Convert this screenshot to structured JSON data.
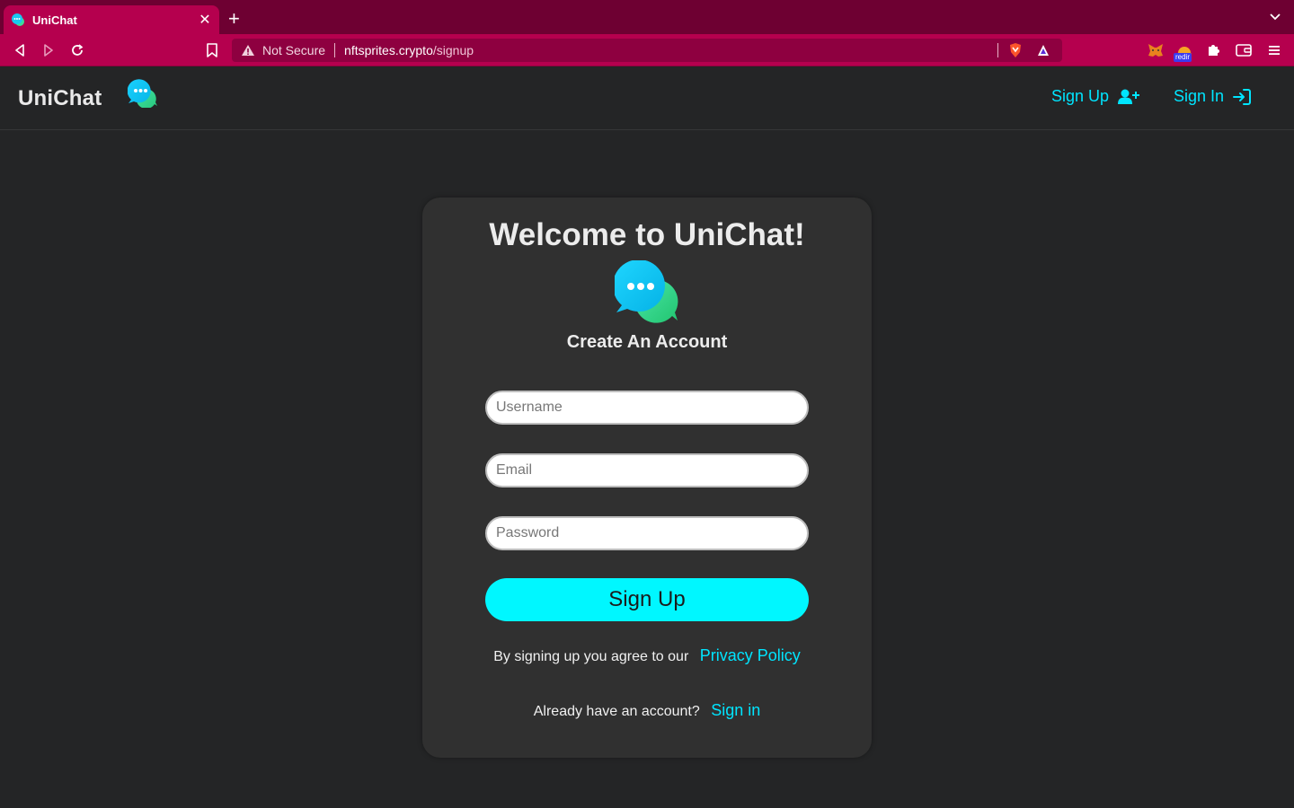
{
  "browser": {
    "tab_title": "UniChat",
    "url_security": "Not Secure",
    "url_host": "nftsprites.crypto",
    "url_path": "/signup",
    "extension_badge": "redir",
    "chrome_color": "#b5004e"
  },
  "header": {
    "brand": "UniChat",
    "signup_label": "Sign Up",
    "signin_label": "Sign In",
    "accent_color": "#00e5ff"
  },
  "card": {
    "title": "Welcome to UniChat!",
    "subtitle": "Create An Account",
    "username_placeholder": "Username",
    "email_placeholder": "Email",
    "password_placeholder": "Password",
    "submit_label": "Sign Up",
    "agree_text": "By signing up you agree to our",
    "privacy_link": "Privacy Policy",
    "have_account_text": "Already have an account?",
    "signin_link": "Sign in"
  }
}
